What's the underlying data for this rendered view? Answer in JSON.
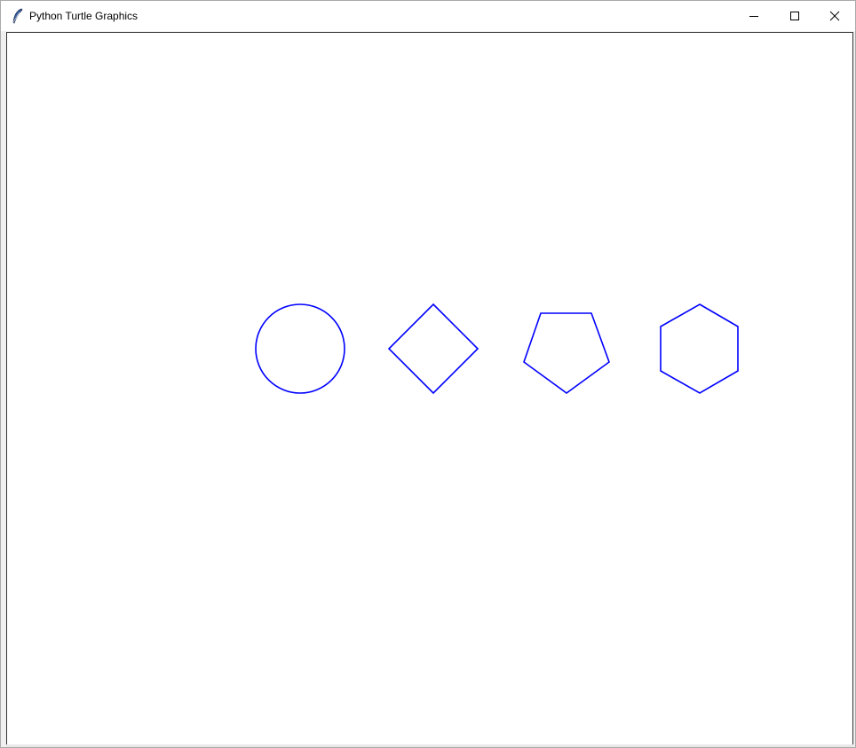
{
  "window": {
    "title": "Python Turtle Graphics",
    "icons": {
      "app": "feather-icon",
      "minimize": "minimize-icon",
      "maximize": "maximize-icon",
      "close": "close-icon"
    }
  },
  "canvas": {
    "background": "#ffffff",
    "pen_color": "#0000ff",
    "shapes": [
      {
        "name": "circle",
        "sides": 0
      },
      {
        "name": "square",
        "sides": 4
      },
      {
        "name": "pentagon",
        "sides": 5
      },
      {
        "name": "hexagon",
        "sides": 6
      }
    ]
  }
}
